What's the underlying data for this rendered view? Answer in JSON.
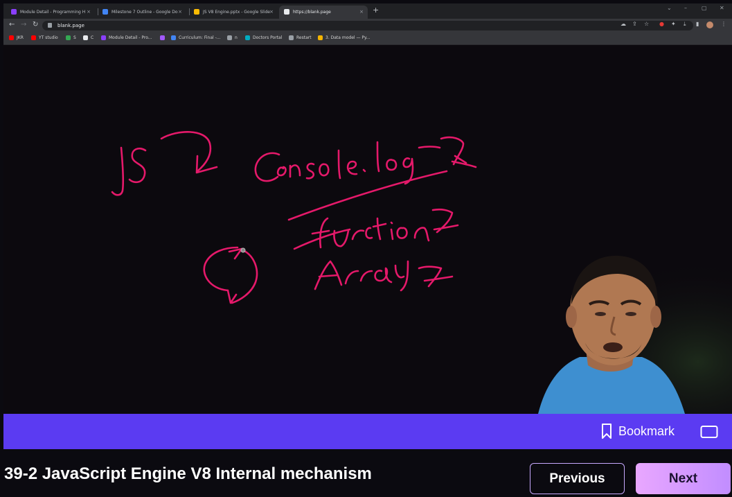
{
  "browser": {
    "tabs": [
      {
        "title": "Module Detail - Programming H",
        "favicon_color": "#8a3ffc",
        "active": false
      },
      {
        "title": "Milestone 7 Outline - Google Do",
        "favicon_color": "#4285f4",
        "active": false
      },
      {
        "title": "JS V8 Engine.pptx - Google Slide",
        "favicon_color": "#fbbc04",
        "active": false
      },
      {
        "title": "https://blank.page",
        "favicon_color": "#e8eaed",
        "active": true
      }
    ],
    "tab_close_glyph": "×",
    "new_tab_glyph": "+",
    "url": "blank.page",
    "bookmarks": [
      {
        "label": "JKR",
        "color": "#ff0000"
      },
      {
        "label": "YT studio",
        "color": "#ff0000"
      },
      {
        "label": "S",
        "color": "#34a853"
      },
      {
        "label": "C",
        "color": "#e8eaed"
      },
      {
        "label": "Module Detail - Pro...",
        "color": "#8a3ffc"
      },
      {
        "label": "",
        "color": "#a259ff"
      },
      {
        "label": "Curriculum: Final -...",
        "color": "#4285f4"
      },
      {
        "label": "n",
        "color": "#9aa0a6"
      },
      {
        "label": "Doctors Portal",
        "color": "#00acc1"
      },
      {
        "label": "Restart",
        "color": "#9aa0a6"
      },
      {
        "label": "3. Data model — Py...",
        "color": "#f4b400"
      }
    ]
  },
  "ink_color": "#e5196a",
  "player": {
    "bookmark_label": "Bookmark",
    "bar_color": "#5b3bf2"
  },
  "lesson": {
    "title": "39-2 JavaScript Engine V8 Internal mechanism",
    "previous_label": "Previous",
    "next_label": "Next"
  }
}
